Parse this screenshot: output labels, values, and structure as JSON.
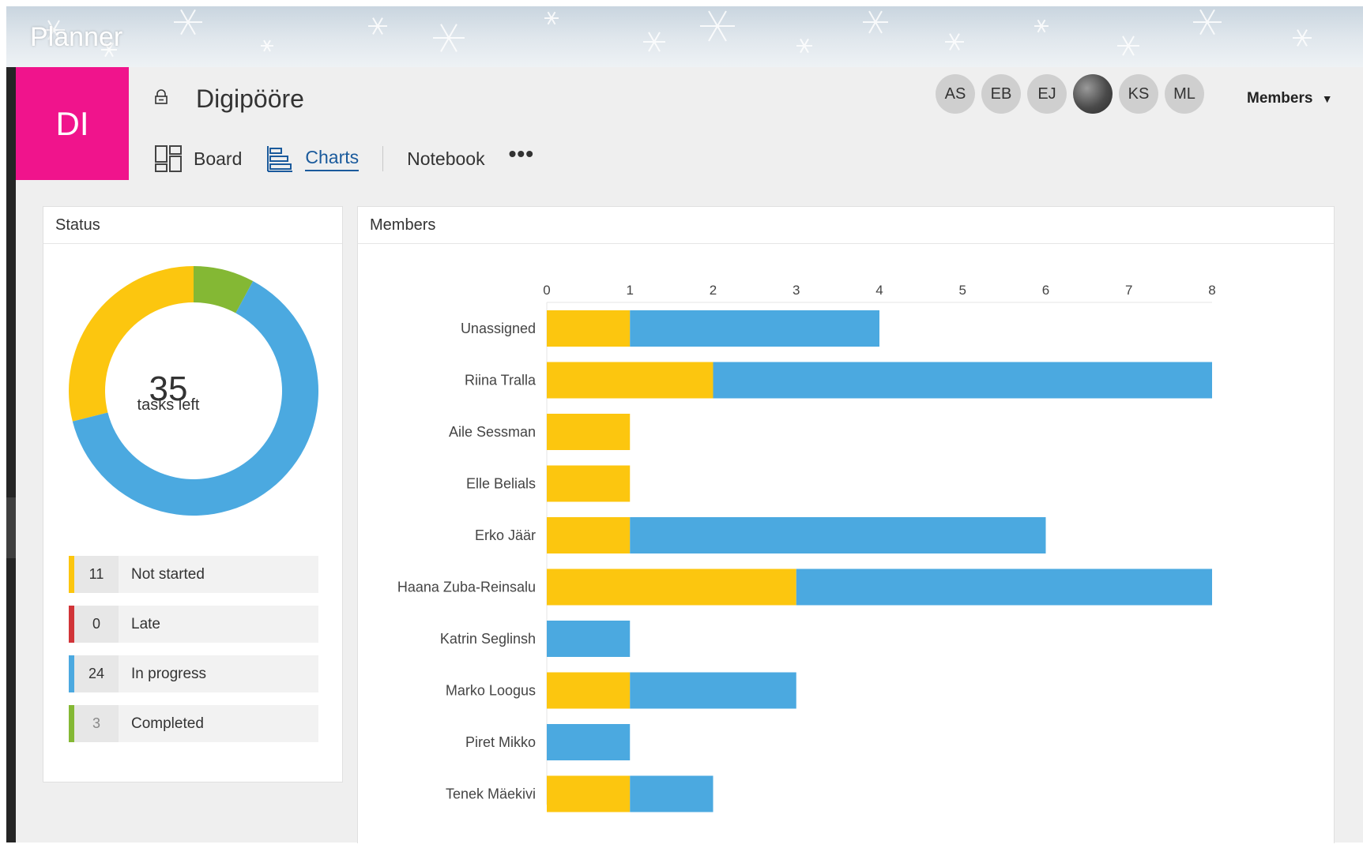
{
  "app": {
    "title": "Planner"
  },
  "plan": {
    "tile_initials": "DI",
    "name": "Digipööre",
    "tile_color": "#f0148c"
  },
  "nav": {
    "board_label": "Board",
    "charts_label": "Charts",
    "notebook_label": "Notebook",
    "more_label": "•••"
  },
  "members": {
    "avatars": [
      "AS",
      "EB",
      "EJ",
      "",
      "KS",
      "ML"
    ],
    "dropdown_label": "Members"
  },
  "status_card": {
    "title": "Status",
    "total": "35",
    "total_label": "tasks left",
    "items": [
      {
        "count": "11",
        "label": "Not started",
        "color": "#fcc60f"
      },
      {
        "count": "0",
        "label": "Late",
        "color": "#d13438"
      },
      {
        "count": "24",
        "label": "In progress",
        "color": "#4ba9e0"
      },
      {
        "count": "3",
        "label": "Completed",
        "color": "#84b834"
      }
    ]
  },
  "members_card": {
    "title": "Members"
  },
  "chart_data": [
    {
      "type": "pie",
      "categories": [
        "Not started",
        "Late",
        "In progress",
        "Completed"
      ],
      "values": [
        11,
        0,
        24,
        3
      ],
      "colors": [
        "#fcc60f",
        "#d13438",
        "#4ba9e0",
        "#84b834"
      ]
    },
    {
      "type": "bar",
      "orientation": "horizontal",
      "stacked": true,
      "categories": [
        "Unassigned",
        "Riina Tralla",
        "Aile Sessman",
        "Elle Belials",
        "Erko Jäär",
        "Haana Zuba-Reinsalu",
        "Katrin Seglinsh",
        "Marko Loogus",
        "Piret Mikko",
        "Tenek Mäekivi"
      ],
      "series": [
        {
          "name": "Not started",
          "color": "#fcc60f",
          "values": [
            1,
            2,
            1,
            1,
            1,
            3,
            0,
            1,
            0,
            1
          ]
        },
        {
          "name": "In progress",
          "color": "#4ba9e0",
          "values": [
            3,
            6,
            0,
            0,
            5,
            5,
            1,
            2,
            1,
            1
          ]
        }
      ],
      "xlim": [
        0,
        8
      ],
      "xticks": [
        "0",
        "1",
        "2",
        "3",
        "4",
        "5",
        "6",
        "7",
        "8"
      ],
      "axis_position": "top"
    }
  ]
}
